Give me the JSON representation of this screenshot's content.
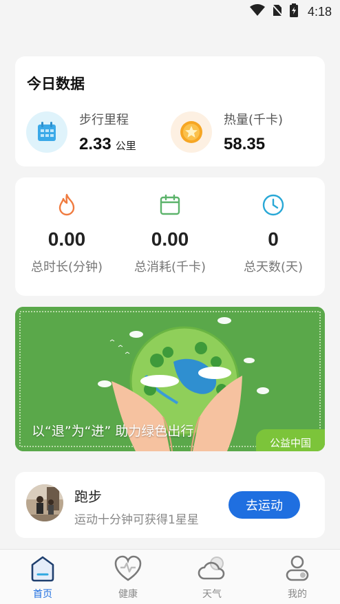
{
  "status_bar": {
    "time": "4:18"
  },
  "today": {
    "title": "今日数据",
    "steps": {
      "label": "步行里程",
      "value": "2.33",
      "unit": "公里",
      "icon": "calendar-icon"
    },
    "calories": {
      "label": "热量(千卡)",
      "value": "58.35",
      "icon": "star-coin-icon"
    }
  },
  "stats": [
    {
      "value": "0.00",
      "label": "总时长(分钟)",
      "icon": "flame-icon",
      "color": "#f07b3f"
    },
    {
      "value": "0.00",
      "label": "总消耗(千卡)",
      "icon": "calendar-icon",
      "color": "#5bb36a"
    },
    {
      "value": "0",
      "label": "总天数(天)",
      "icon": "clock-icon",
      "color": "#29a8d6"
    }
  ],
  "banner": {
    "caption": "以“退”为“进” 助力绿色出行",
    "tag": "公益中国"
  },
  "run": {
    "title": "跑步",
    "desc": "运动十分钟可获得1星星",
    "button": "去运动"
  },
  "tabs": [
    {
      "label": "首页",
      "icon": "home-icon",
      "active": true
    },
    {
      "label": "健康",
      "icon": "heart-icon",
      "active": false
    },
    {
      "label": "天气",
      "icon": "cloud-icon",
      "active": false
    },
    {
      "label": "我的",
      "icon": "user-icon",
      "active": false
    }
  ],
  "colors": {
    "accent": "#1f6fe0",
    "tag_green": "#7cc43a"
  }
}
